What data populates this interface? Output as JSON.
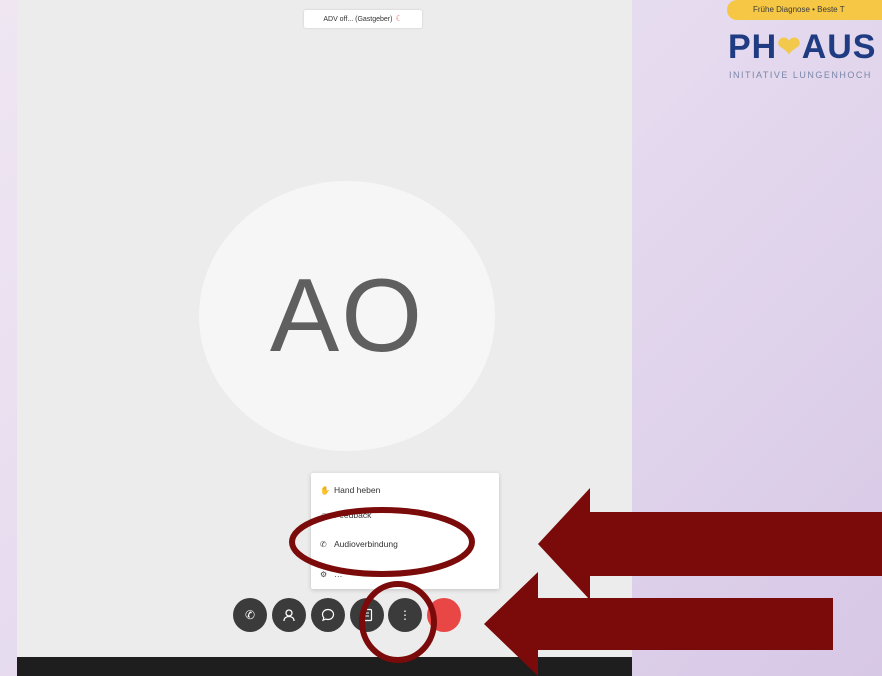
{
  "call": {
    "host_label": "ADV off... (Gastgeber)",
    "avatar_initials": "AO"
  },
  "menu": {
    "items": [
      {
        "label": "Hand heben",
        "icon": "hand-icon"
      },
      {
        "label": "Feedback",
        "icon": "feedback-icon"
      },
      {
        "label": "Audioverbindung",
        "icon": "phone-icon"
      },
      {
        "label": "…",
        "icon": "settings-icon"
      }
    ]
  },
  "toolbar": {
    "buttons": [
      {
        "icon": "phone-icon"
      },
      {
        "icon": "user-icon"
      },
      {
        "icon": "chat-icon"
      },
      {
        "icon": "document-icon"
      },
      {
        "icon": "more-icon"
      },
      {
        "icon": "hang-up-icon"
      }
    ]
  },
  "branding": {
    "banner": "Frühe Diagnose • Beste T",
    "logo_left": "PH",
    "logo_right": "AUS",
    "tagline": "INITIATIVE LUNGENHOCH"
  },
  "colors": {
    "arrow": "#7b0a0a",
    "hang_up": "#e94745",
    "logo_blue": "#1f3b82",
    "banner_yellow": "#f6c744"
  }
}
